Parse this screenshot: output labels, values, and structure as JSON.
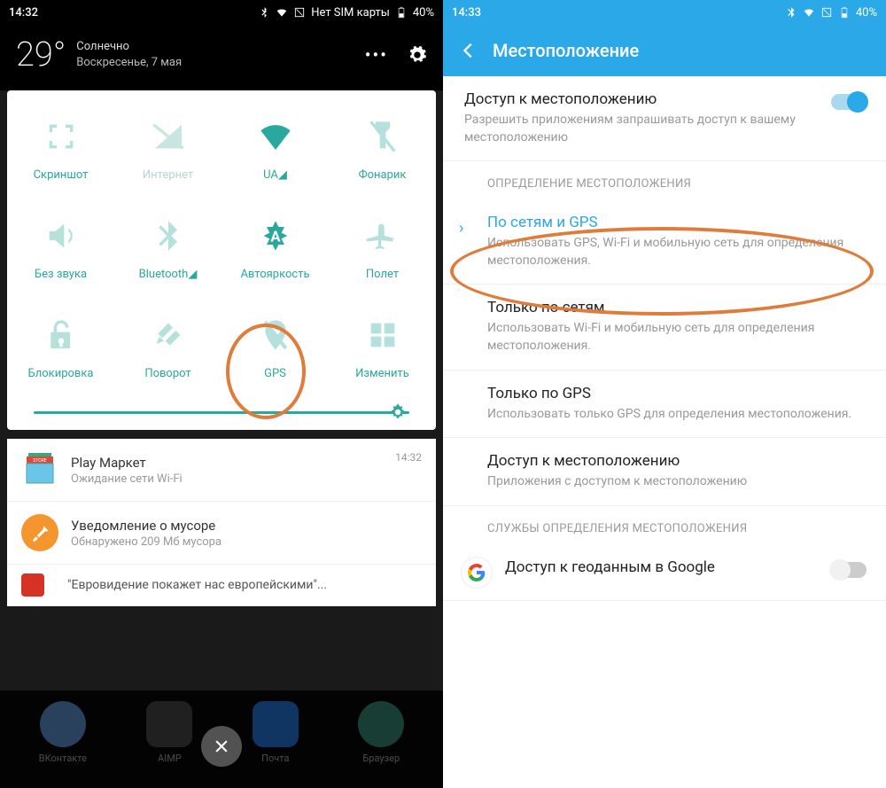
{
  "left": {
    "status": {
      "time": "14:32",
      "sim": "Нет SIM карты",
      "battery": "40%"
    },
    "weather": {
      "temp": "29°",
      "cond": "Солнечно",
      "date": "Воскресенье, 7 мая"
    },
    "tiles": [
      {
        "label": "Скриншот"
      },
      {
        "label": "Интернет"
      },
      {
        "label": "UA◢"
      },
      {
        "label": "Фонарик"
      },
      {
        "label": "Без звука"
      },
      {
        "label": "Bluetooth◢"
      },
      {
        "label": "Автояркость"
      },
      {
        "label": "Полет"
      },
      {
        "label": "Блокировка"
      },
      {
        "label": "Поворот"
      },
      {
        "label": "GPS"
      },
      {
        "label": "Изменить"
      }
    ],
    "notifs": {
      "play": {
        "title": "Play Маркет",
        "sub": "Ожидание сети Wi-Fi",
        "time": "14:32"
      },
      "trash": {
        "title": "Уведомление о мусоре",
        "sub": "Обнаружено 209 Мб мусора"
      },
      "news": {
        "text": "\"Евровидение покажет нас европейскими\"..."
      }
    },
    "dock": [
      "ВКонтакте",
      "AIMP",
      "Почта",
      "Браузер"
    ]
  },
  "right": {
    "status": {
      "time": "14:33",
      "battery": "40%"
    },
    "title": "Местоположение",
    "access": {
      "title": "Доступ к местоположению",
      "sub": "Разрешить приложениям запрашивать доступ к вашему местоположению"
    },
    "section1": "ОПРЕДЕЛЕНИЕ МЕСТОПОЛОЖЕНИЯ",
    "mode1": {
      "title": "По сетям и GPS",
      "sub": "Использовать GPS, Wi-Fi и мобильную сеть для определения местоположения."
    },
    "mode2": {
      "title": "Только по сетям",
      "sub": "Использовать Wi-Fi и мобильную сеть для определения местоположения."
    },
    "mode3": {
      "title": "Только по GPS",
      "sub": "Использовать только GPS для определения местоположения."
    },
    "appaccess": {
      "title": "Доступ к местоположению",
      "sub": "Приложения с доступом к местоположению"
    },
    "section2": "СЛУЖБЫ ОПРЕДЕЛЕНИЯ МЕСТОПОЛОЖЕНИЯ",
    "google": {
      "title": "Доступ к геоданным в Google"
    }
  }
}
